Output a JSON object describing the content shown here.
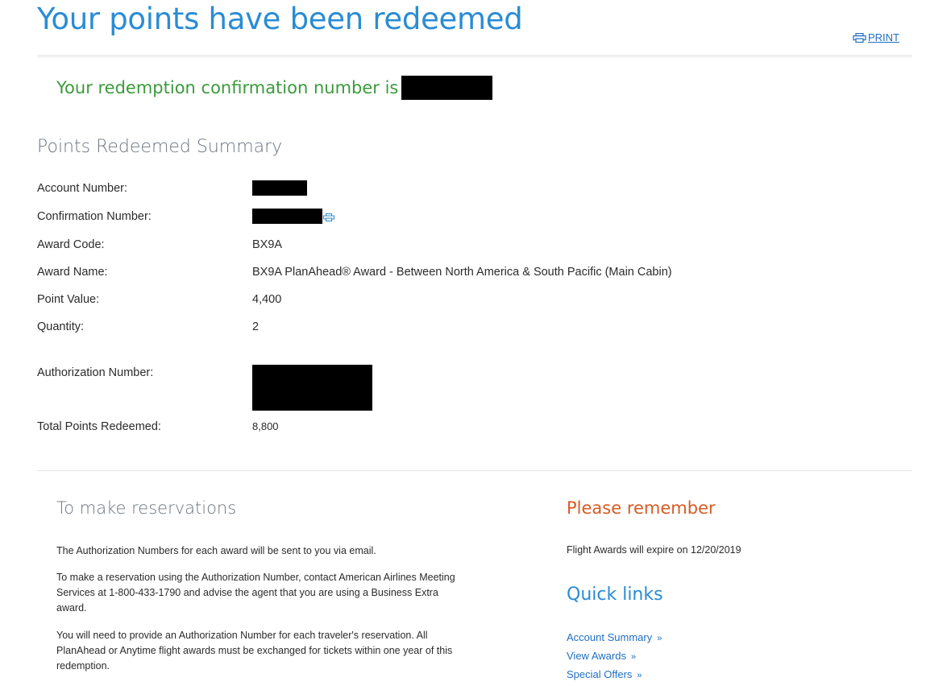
{
  "header": {
    "title": "Your points have been redeemed",
    "print_label": "PRINT"
  },
  "confirmation": {
    "text": "Your redemption confirmation number is"
  },
  "summary": {
    "title": "Points Redeemed Summary",
    "account_number_label": "Account Number:",
    "confirmation_number_label": "Confirmation Number:",
    "award_code_label": "Award Code:",
    "award_code_value": "BX9A",
    "award_name_label": "Award Name:",
    "award_name_value": "BX9A PlanAhead® Award - Between North America & South Pacific (Main Cabin)",
    "point_value_label": "Point Value:",
    "point_value_value": "4,400",
    "quantity_label": "Quantity:",
    "quantity_value": "2",
    "authorization_number_label": "Authorization Number:",
    "total_points_label": "Total Points Redeemed:",
    "total_points_value": "8,800"
  },
  "reservations": {
    "title": "To make reservations",
    "paragraphs": [
      "The Authorization Numbers for each award will be sent to you via email.",
      "To make a reservation using the Authorization Number, contact American Airlines Meeting Services at 1-800-433-1790 and advise the agent that you are using a Business Extra award.",
      "You will need to provide an Authorization Number for each traveler's reservation. All PlanAhead or Anytime flight awards must be exchanged for tickets within one year of this redemption."
    ]
  },
  "remember": {
    "title": "Please remember",
    "text": "Flight Awards will expire on 12/20/2019"
  },
  "quick_links": {
    "title": "Quick links",
    "arrow": "»",
    "items": [
      "Account Summary",
      "View Awards",
      "Special Offers"
    ]
  },
  "colors": {
    "title_blue": "#2a8cd4",
    "link_blue": "#1f6fc2",
    "confirmation_green": "#3b9a3b",
    "remember_orange": "#d95b23",
    "redaction": "#000000"
  },
  "icons": {
    "print": "printer-icon"
  }
}
